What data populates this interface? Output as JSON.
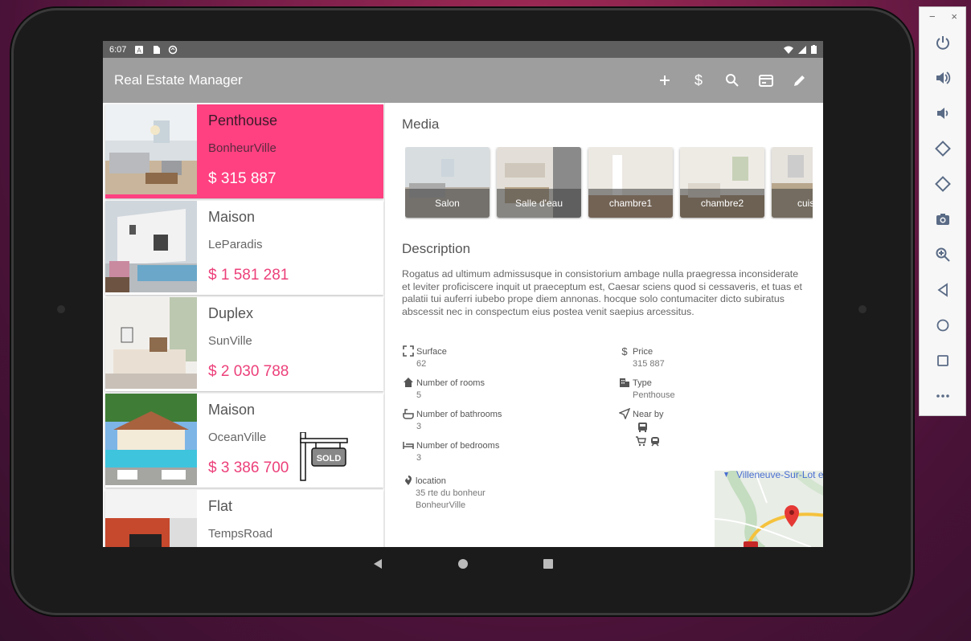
{
  "app": {
    "title": "Real Estate Manager"
  },
  "status_bar": {
    "time": "6:07"
  },
  "toolbar": {
    "actions": [
      "add-icon",
      "dollar-icon",
      "search-icon",
      "payment-icon",
      "edit-icon"
    ]
  },
  "list": {
    "items": [
      {
        "type": "Penthouse",
        "city": "BonheurVille",
        "price": "$ 315 887",
        "selected": true,
        "sold": false
      },
      {
        "type": "Maison",
        "city": "LeParadis",
        "price": "$ 1 581 281",
        "selected": false,
        "sold": false
      },
      {
        "type": "Duplex",
        "city": "SunVille",
        "price": "$ 2 030 788",
        "selected": false,
        "sold": false
      },
      {
        "type": "Maison",
        "city": "OceanVille",
        "price": "$ 3 386 700",
        "selected": false,
        "sold": true
      },
      {
        "type": "Flat",
        "city": "TempsRoad",
        "price": "",
        "selected": false,
        "sold": false
      }
    ],
    "sold_label": "SOLD"
  },
  "detail": {
    "media_title": "Media",
    "media": [
      {
        "caption": "Salon"
      },
      {
        "caption": "Salle d'eau"
      },
      {
        "caption": "chambre1"
      },
      {
        "caption": "chambre2"
      },
      {
        "caption": "cuis"
      }
    ],
    "description_title": "Description",
    "description": "Rogatus ad ultimum admissusque in consistorium ambage nulla praegressa inconsiderate et leviter proficiscere inquit ut praeceptum est, Caesar sciens quod si cessaveris, et tuas et palatii tui auferri iubebo prope diem annonas. hocque solo contumaciter dicto subiratus abscessit nec in conspectum eius postea venit saepius arcessitus.",
    "surface": {
      "label": "Surface",
      "value": "62"
    },
    "rooms": {
      "label": "Number of rooms",
      "value": "5"
    },
    "bathrooms": {
      "label": "Number of bathrooms",
      "value": "3"
    },
    "bedrooms": {
      "label": "Number of bedrooms",
      "value": "3"
    },
    "price": {
      "label": "Price",
      "value": "315 887"
    },
    "type": {
      "label": "Type",
      "value": "Penthouse"
    },
    "near_by": {
      "label": "Near by",
      "icons": [
        "bus-icon",
        "cart-icon",
        "train-icon"
      ]
    },
    "location": {
      "label": "location",
      "address_line1": "35 rte du bonheur",
      "address_line2": "BonheurVille"
    },
    "map": {
      "label": "Villeneuve-Sur-Lot et..."
    }
  },
  "emulator_panel": {
    "window_controls": [
      "minimize-icon",
      "close-icon"
    ],
    "buttons": [
      "power-icon",
      "volume-up-icon",
      "volume-down-icon",
      "rotate-left-icon",
      "rotate-right-icon",
      "camera-icon",
      "zoom-icon",
      "back-icon",
      "home-icon",
      "overview-icon",
      "more-icon"
    ]
  },
  "colors": {
    "accent": "#ff4081",
    "price": "#ec407a",
    "appbar": "#9e9e9e",
    "statusbar": "#5f5f5f"
  }
}
